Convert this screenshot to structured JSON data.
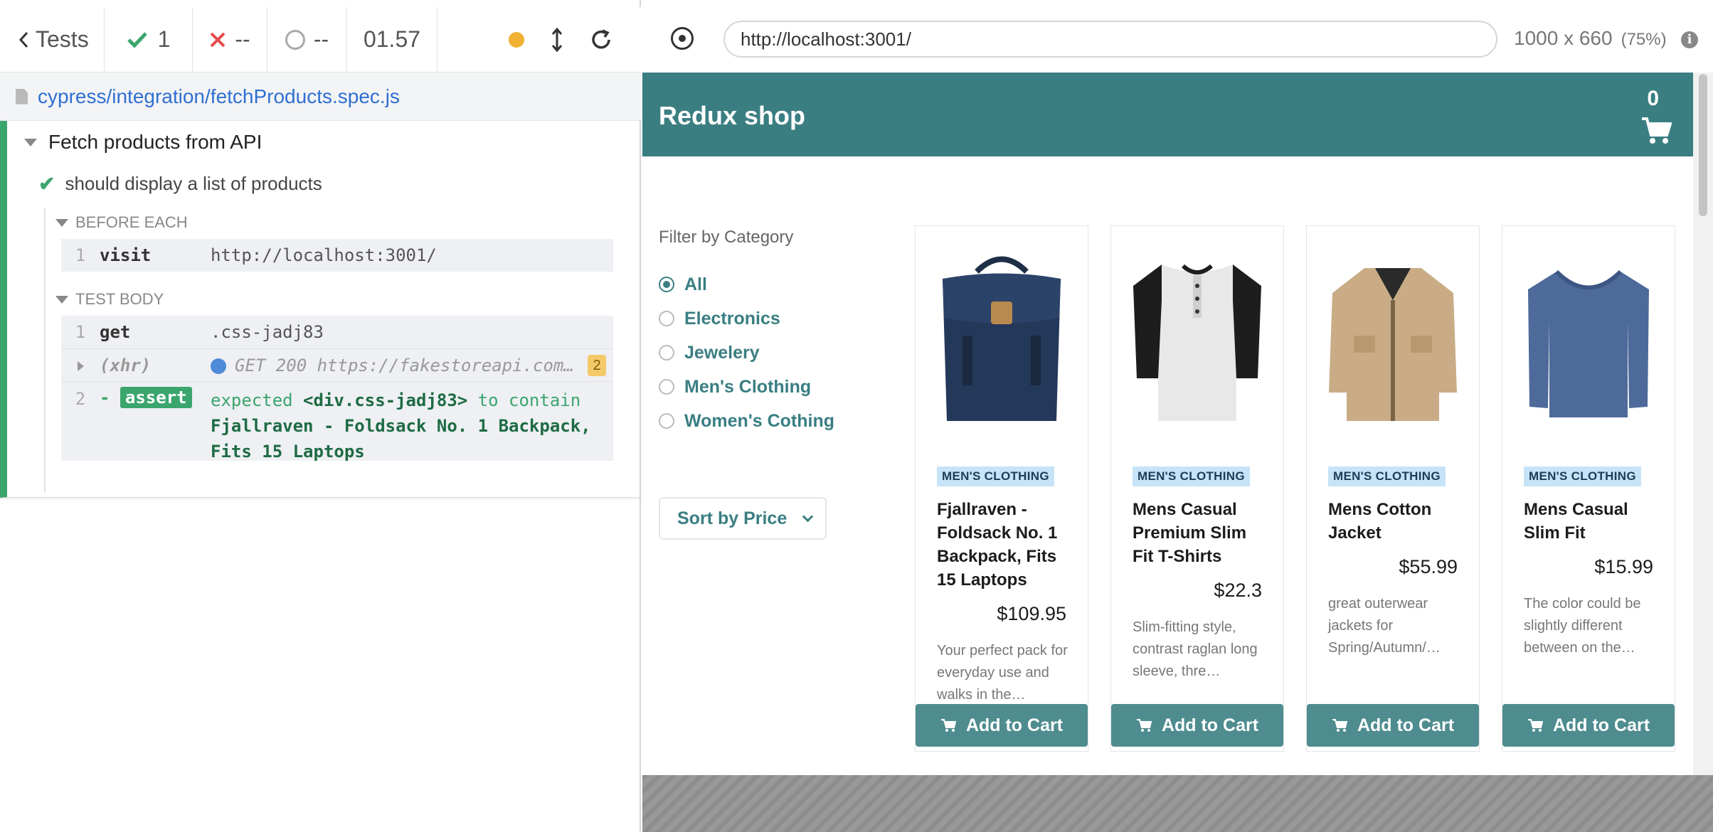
{
  "runner": {
    "tests_label": "Tests",
    "passed": "1",
    "failed": "--",
    "pending": "--",
    "duration": "01.57",
    "spec_path": "cypress/integration/fetchProducts.spec.js",
    "suite_title": "Fetch products from API",
    "test_title": "should display a list of products",
    "before_each_label": "BEFORE EACH",
    "test_body_label": "TEST BODY",
    "before_each_cmds": [
      {
        "num": "1",
        "name": "visit",
        "msg": "http://localhost:3001/"
      }
    ],
    "body_cmds": [
      {
        "num": "1",
        "name": "get",
        "msg": ".css-jadj83"
      },
      {
        "name": "(xhr)",
        "msg": "GET 200 https://fakestoreapi.com…",
        "count": "2"
      },
      {
        "num": "2",
        "prefix": "-",
        "tag": "assert",
        "msg_expected": "expected",
        "msg_subject": "<div.css-jadj83>",
        "msg_rel": "to contain",
        "msg_value": "Fjallraven - Foldsack No. 1 Backpack, Fits 15 Laptops"
      }
    ]
  },
  "preview": {
    "url": "http://localhost:3001/",
    "viewport": "1000 x 660",
    "scale": "(75%)"
  },
  "app": {
    "brand": "Redux shop",
    "cart_count": "0",
    "filter_title": "Filter by Category",
    "categories": [
      "All",
      "Electronics",
      "Jewelery",
      "Men's Clothing",
      "Women's Cothing"
    ],
    "selected_category": "All",
    "sort_label": "Sort by Price",
    "add_label": "Add to Cart",
    "products": [
      {
        "category": "MEN'S CLOTHING",
        "title": "Fjallraven - Foldsack No. 1 Backpack, Fits 15 Laptops",
        "price": "$109.95",
        "desc": "Your perfect pack for everyday use and walks in the…"
      },
      {
        "category": "MEN'S CLOTHING",
        "title": "Mens Casual Premium Slim Fit T-Shirts",
        "price": "$22.3",
        "desc": "Slim-fitting style, contrast raglan long sleeve, thre…"
      },
      {
        "category": "MEN'S CLOTHING",
        "title": "Mens Cotton Jacket",
        "price": "$55.99",
        "desc": "great outerwear jackets for Spring/Autumn/…"
      },
      {
        "category": "MEN'S CLOTHING",
        "title": "Mens Casual Slim Fit",
        "price": "$15.99",
        "desc": "The color could be slightly different between on the…"
      }
    ]
  },
  "colors": {
    "pass": "#3ba56e",
    "fail": "#e34c4c",
    "brand": "#3a7e82",
    "button": "#4e8c8f"
  }
}
